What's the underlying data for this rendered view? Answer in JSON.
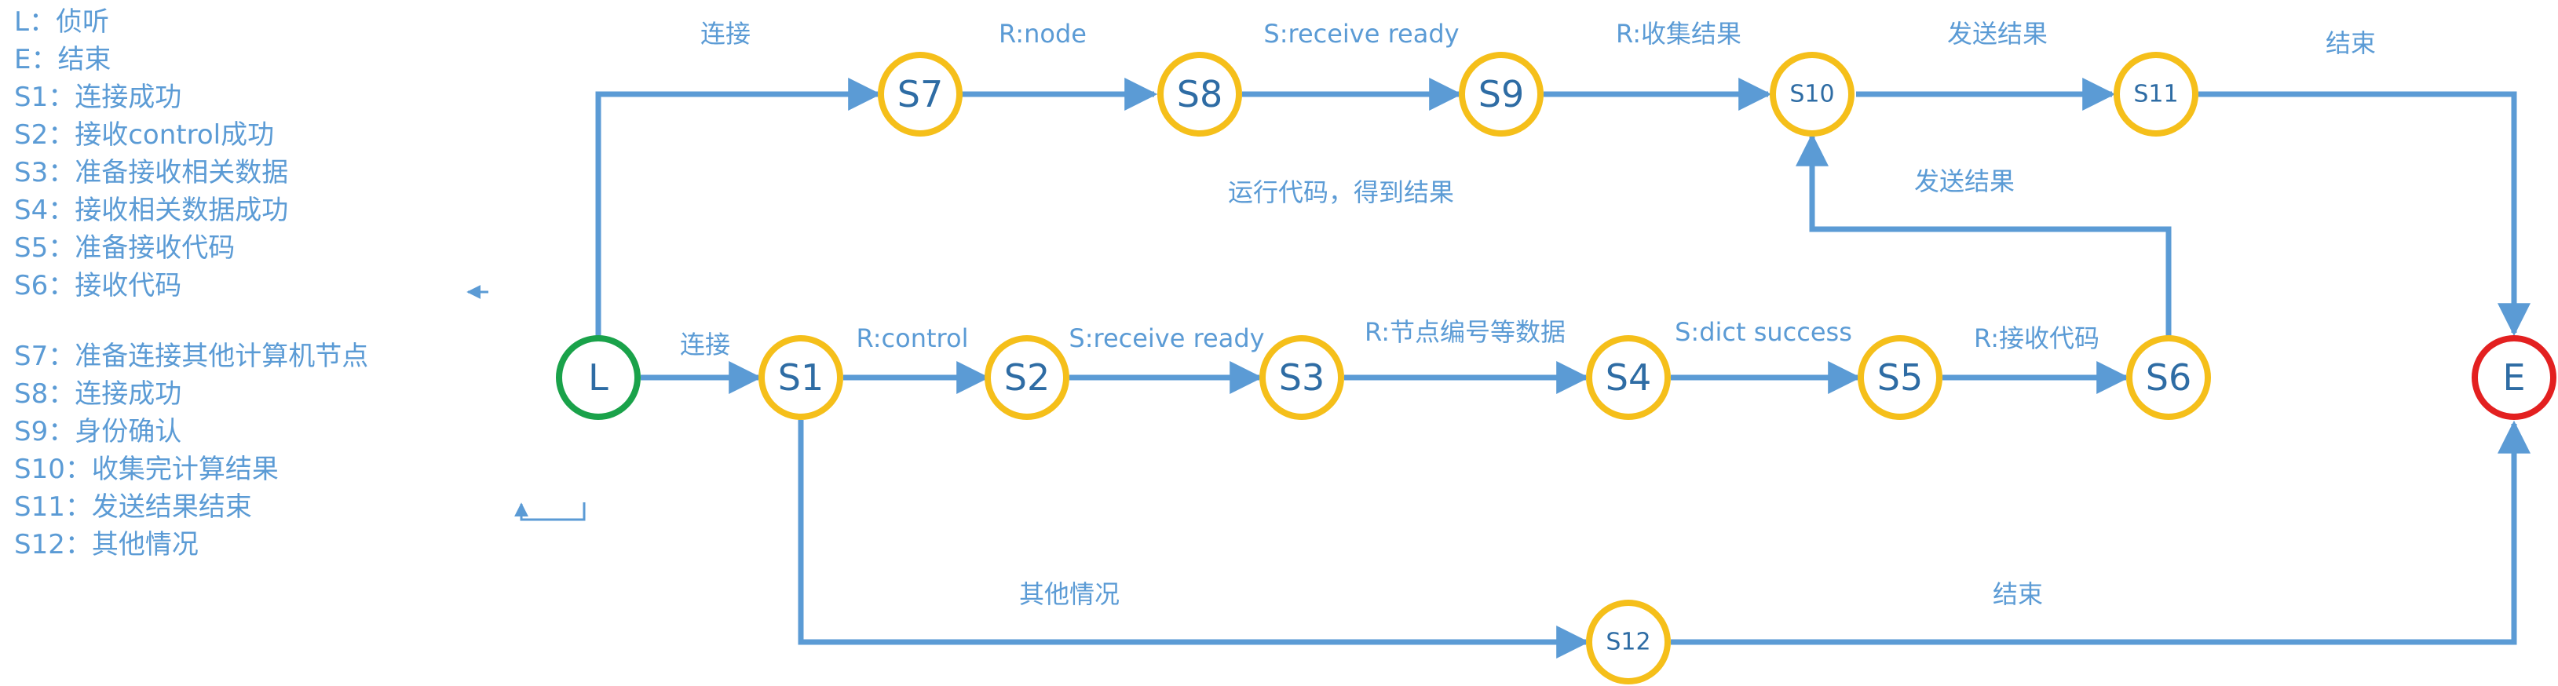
{
  "colors": {
    "edge": "#5b9bd5",
    "node_border": "#f5bf1a",
    "start_border": "#1aa24a",
    "end_border": "#e32020",
    "text": "#5b9bd5",
    "node_text": "#2e6ca4"
  },
  "legend": [
    "L：侦听",
    "E：结束",
    "S1：连接成功",
    "S2：接收control成功",
    "S3：准备接收相关数据",
    "S4：接收相关数据成功",
    "S5：准备接收代码",
    "S6：接收代码",
    "S7：准备连接其他计算机节点",
    "S8：连接成功",
    "S9：身份确认",
    "S10：收集完计算结果",
    "S11：发送结果结束",
    "S12：其他情况"
  ],
  "nodes": {
    "L": "L",
    "S1": "S1",
    "S2": "S2",
    "S3": "S3",
    "S4": "S4",
    "S5": "S5",
    "S6": "S6",
    "S7": "S7",
    "S8": "S8",
    "S9": "S9",
    "S10": "S10",
    "S11": "S11",
    "S12": "S12",
    "E": "E"
  },
  "edge_labels": {
    "L_S7": "连接",
    "S7_S8": "R:node",
    "S8_S9": "S:receive ready",
    "S9_S10": "R:收集结果",
    "S10_S11": "发送结果",
    "S11_E": "结束",
    "run_code": "运行代码，得到结果",
    "S6_S10": "发送结果",
    "L_S1": "连接",
    "S1_S2": "R:control",
    "S2_S3": "S:receive ready",
    "S3_S4": "R:节点编号等数据",
    "S4_S5": "S:dict success",
    "S5_S6": "R:接收代码",
    "S1_S12": "其他情况",
    "S12_E": "结束"
  }
}
